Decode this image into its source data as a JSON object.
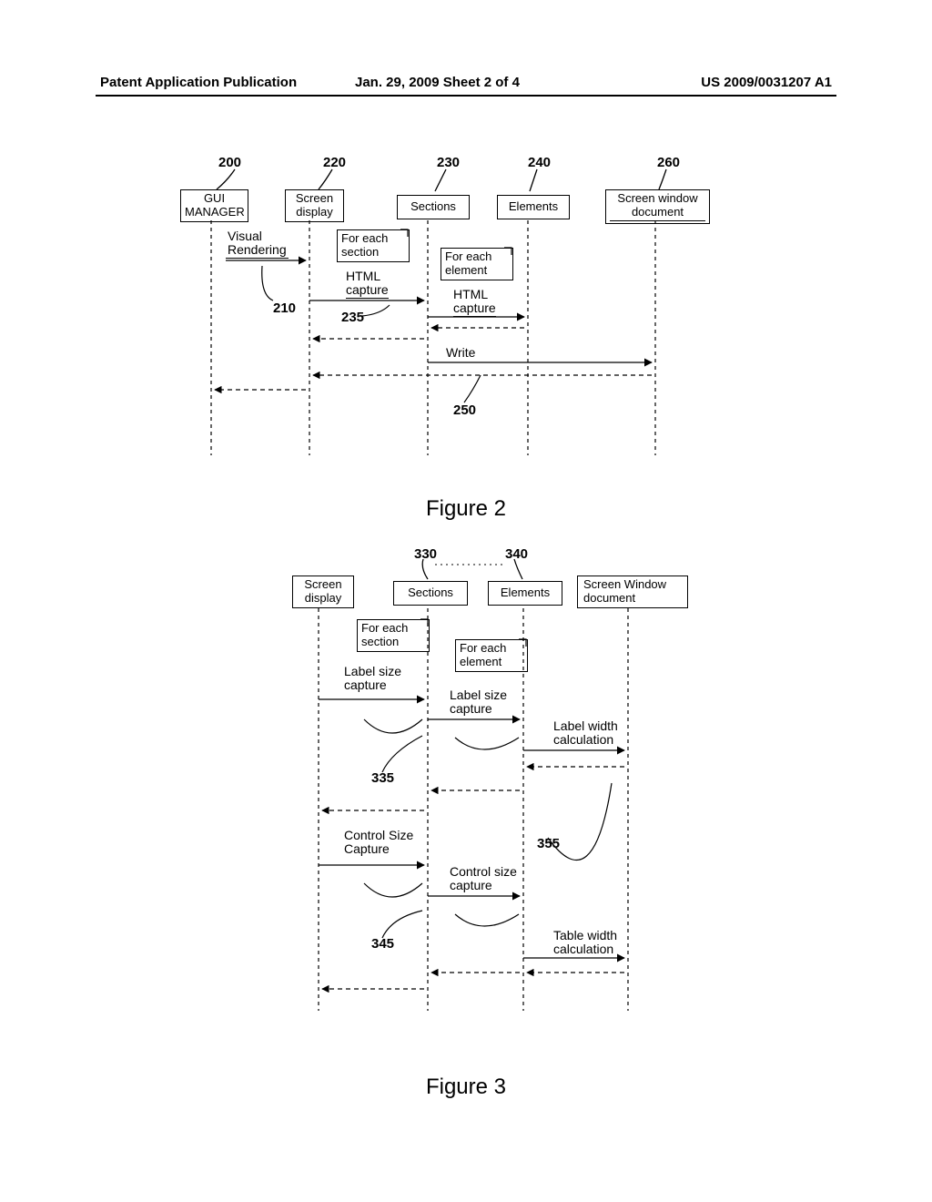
{
  "header": {
    "left": "Patent Application Publication",
    "mid": "Jan. 29, 2009  Sheet 2 of 4",
    "right": "US 2009/0031207 A1"
  },
  "fig2": {
    "caption": "Figure 2",
    "refs": {
      "r200": "200",
      "r210": "210",
      "r220": "220",
      "r230": "230",
      "r235": "235",
      "r240": "240",
      "r250": "250",
      "r260": "260"
    },
    "boxes": {
      "gui": "GUI\nMANAGER",
      "screen": "Screen\ndisplay",
      "sections": "Sections",
      "elements": "Elements",
      "swd": "Screen window\ndocument",
      "foreach_section": "For each\nsection",
      "foreach_element": "For each\nelement"
    },
    "msgs": {
      "visual": "Visual\nRendering",
      "html1": "HTML\ncapture",
      "html2": "HTML\ncapture",
      "write": "Write"
    }
  },
  "fig3": {
    "caption": "Figure 3",
    "refs": {
      "r330": "330",
      "r335": "335",
      "r340": "340",
      "r345": "345",
      "r355": "355"
    },
    "boxes": {
      "screen": "Screen\ndisplay",
      "sections": "Sections",
      "elements": "Elements",
      "swd": "Screen Window\ndocument",
      "foreach_section": "For each\nsection",
      "foreach_element": "For each\nelement"
    },
    "msgs": {
      "lsc1": "Label size\ncapture",
      "lsc2": "Label size\ncapture",
      "lwc": "Label width\ncalculation",
      "csc1": "Control Size\nCapture",
      "csc2": "Control size\ncapture",
      "twc": "Table width\ncalculation"
    }
  }
}
